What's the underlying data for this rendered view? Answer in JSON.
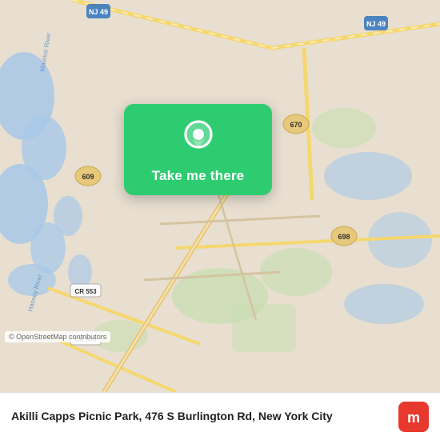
{
  "map": {
    "background_color": "#e8e0d8",
    "attribution": "© OpenStreetMap contributors"
  },
  "card": {
    "label": "Take me there",
    "background_color": "#2ecc71"
  },
  "bottom_bar": {
    "place_name": "Akilli Capps Picnic Park, 476 S Burlington Rd, New York City"
  }
}
